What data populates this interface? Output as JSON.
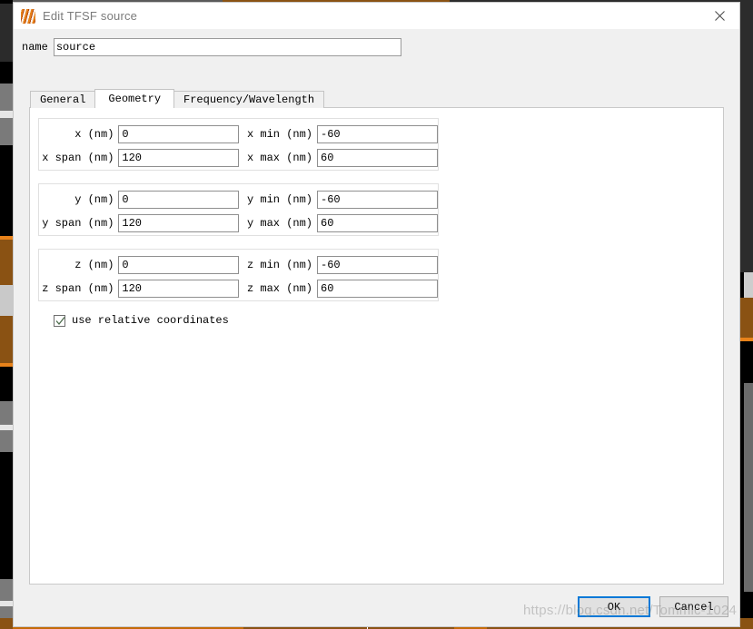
{
  "window": {
    "title": "Edit TFSF source",
    "app_icon": "lumerical-flame-icon",
    "close_icon": "close-icon"
  },
  "name_field": {
    "label": "name",
    "value": "source",
    "placeholder": ""
  },
  "tabs": [
    {
      "label": "General",
      "active": false
    },
    {
      "label": "Geometry",
      "active": true
    },
    {
      "label": "Frequency/Wavelength",
      "active": false
    }
  ],
  "geometry": {
    "groups": [
      {
        "axis": "x",
        "rows": [
          {
            "left_label": "x (nm)",
            "left_value": "0",
            "right_label": "x min (nm)",
            "right_value": "-60"
          },
          {
            "left_label": "x span (nm)",
            "left_value": "120",
            "right_label": "x max (nm)",
            "right_value": "60"
          }
        ]
      },
      {
        "axis": "y",
        "rows": [
          {
            "left_label": "y (nm)",
            "left_value": "0",
            "right_label": "y min (nm)",
            "right_value": "-60"
          },
          {
            "left_label": "y span (nm)",
            "left_value": "120",
            "right_label": "y max (nm)",
            "right_value": "60"
          }
        ]
      },
      {
        "axis": "z",
        "rows": [
          {
            "left_label": "z (nm)",
            "left_value": "0",
            "right_label": "z min (nm)",
            "right_value": "-60"
          },
          {
            "left_label": "z span (nm)",
            "left_value": "120",
            "right_label": "z max (nm)",
            "right_value": "60"
          }
        ]
      }
    ],
    "relative_coordinates": {
      "label": "use relative coordinates",
      "checked": true,
      "icon": "checkmark-icon"
    }
  },
  "buttons": {
    "ok": "OK",
    "cancel": "Cancel"
  },
  "watermark": {
    "text": "https://blog.csdn.net/Tommic-1024"
  },
  "colors": {
    "accent": "#0078d7",
    "titlebar_text": "#7b7b7b",
    "dialog_bg": "#f0f0f0",
    "panel_bg": "#ffffff",
    "taskbar": "#c46a08",
    "taskbar_seg": "#8a5213"
  }
}
